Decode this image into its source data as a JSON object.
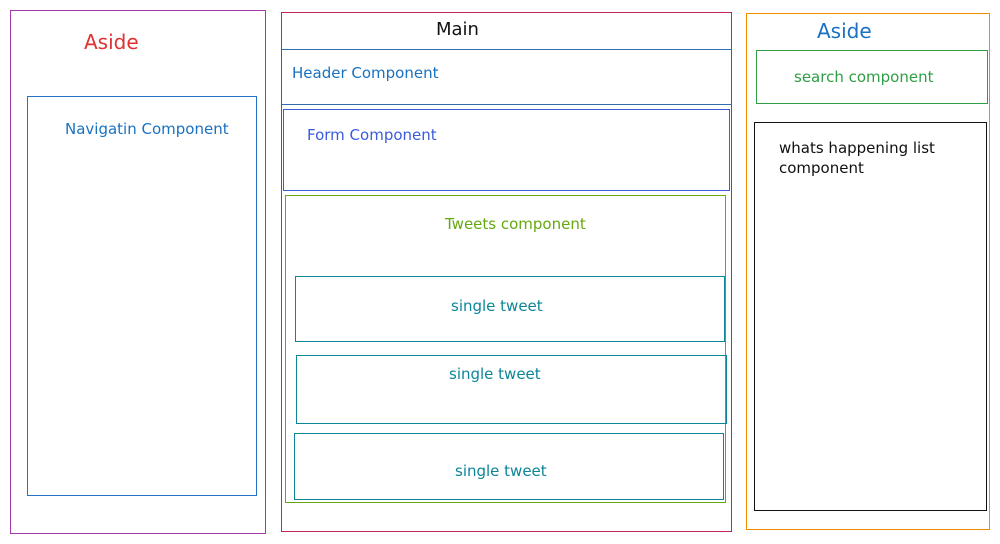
{
  "left_aside": {
    "title": "Aside",
    "nav_label": "Navigatin Component"
  },
  "main": {
    "title": "Main",
    "header_label": "Header Component",
    "form_label": "Form Component",
    "tweets_label": "Tweets component",
    "tweets": [
      {
        "label": "single tweet"
      },
      {
        "label": "single tweet"
      },
      {
        "label": "single tweet"
      }
    ]
  },
  "right_aside": {
    "title": "Aside",
    "search_label": "search component",
    "happening_label_line1": "whats happening list",
    "happening_label_line2": "component"
  },
  "colors": {
    "left_aside_border": "#a03aa8",
    "left_aside_title": "#e03131",
    "nav_border": "#2771c2",
    "main_border": "#c2255c",
    "header_border": "#2f6fb0",
    "form_border": "#3b5bdb",
    "tweets_border": "#66a80f",
    "tweet_border": "#0c8599",
    "right_aside_border": "#f08c00",
    "right_aside_title": "#1971c2",
    "search_border": "#2f9e44",
    "happening_border": "#111111"
  }
}
